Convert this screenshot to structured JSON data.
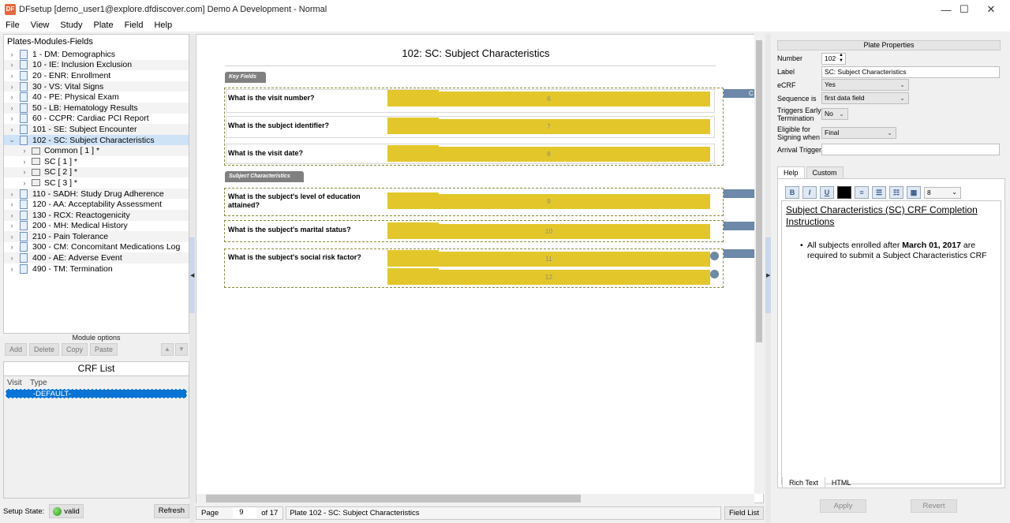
{
  "window": {
    "app_icon": "DF",
    "title": "DFsetup [demo_user1@explore.dfdiscover.com] Demo A Development - Normal",
    "controls": [
      "—",
      "☐",
      "✕"
    ]
  },
  "menu": [
    "File",
    "View",
    "Study",
    "Plate",
    "Field",
    "Help"
  ],
  "tree": {
    "header": "Plates-Modules-Fields",
    "items": [
      {
        "label": "1 - DM: Demographics",
        "expanded": false
      },
      {
        "label": "10 - IE: Inclusion Exclusion",
        "expanded": false
      },
      {
        "label": "20 - ENR: Enrollment",
        "expanded": false
      },
      {
        "label": "30 - VS: Vital Signs",
        "expanded": false
      },
      {
        "label": "40 - PE: Physical Exam",
        "expanded": false
      },
      {
        "label": "50 - LB: Hematology Results",
        "expanded": false
      },
      {
        "label": "60 - CCPR: Cardiac PCI Report",
        "expanded": false
      },
      {
        "label": "101 - SE: Subject Encounter",
        "expanded": false
      },
      {
        "label": "102 - SC: Subject Characteristics",
        "expanded": true,
        "selected": true
      },
      {
        "label": "Common [ 1 ] *",
        "child": true
      },
      {
        "label": "SC [ 1 ] *",
        "child": true
      },
      {
        "label": "SC [ 2 ] *",
        "child": true
      },
      {
        "label": "SC [ 3 ] *",
        "child": true
      },
      {
        "label": "110 - SADH: Study Drug Adherence",
        "expanded": false
      },
      {
        "label": "120 - AA: Acceptability Assessment",
        "expanded": false
      },
      {
        "label": "130 - RCX: Reactogenicity",
        "expanded": false
      },
      {
        "label": "200 - MH: Medical History",
        "expanded": false
      },
      {
        "label": "210 - Pain Tolerance",
        "expanded": false
      },
      {
        "label": "300 - CM: Concomitant Medications Log",
        "expanded": false
      },
      {
        "label": "400 - AE: Adverse Event",
        "expanded": false
      },
      {
        "label": "490 - TM: Termination",
        "expanded": false
      }
    ]
  },
  "module_options": {
    "title": "Module options",
    "buttons": {
      "add": "Add",
      "delete": "Delete",
      "copy": "Copy",
      "paste": "Paste"
    }
  },
  "crf_list": {
    "title": "CRF List",
    "col_visit": "Visit",
    "col_type": "Type",
    "row": "-DEFAULT-"
  },
  "setup": {
    "label": "Setup State:",
    "state": "valid",
    "refresh": "Refresh"
  },
  "plate": {
    "title": "102: SC: Subject Characteristics",
    "sections": [
      "Key Fields",
      "Subject Characteristics"
    ],
    "questions": [
      {
        "label": "What is the visit number?",
        "fields": [
          "6"
        ]
      },
      {
        "label": "What is the subject identifier?",
        "fields": [
          "7"
        ]
      },
      {
        "label": "What is the visit date?",
        "fields": [
          "8"
        ]
      },
      {
        "label": "What is the subject's level of education attained?",
        "fields": [
          "9"
        ]
      },
      {
        "label": "What is the subject's marital status?",
        "fields": [
          "10"
        ]
      },
      {
        "label": "What is the subject's social risk factor?",
        "fields": [
          "11",
          "12"
        ]
      }
    ],
    "edge_marker": "C",
    "field_color": "#e3c72a"
  },
  "status": {
    "page_label": "Page",
    "page": "9",
    "of": "of 17",
    "plate": "Plate 102 - SC: Subject Characteristics",
    "field_list": "Field List"
  },
  "properties": {
    "title": "Plate Properties",
    "number_label": "Number",
    "number": "102",
    "label_label": "Label",
    "label": "SC: Subject Characteristics",
    "ecrf_label": "eCRF",
    "ecrf": "Yes",
    "sequence_label": "Sequence is",
    "sequence": "first data field",
    "triggers_label": "Triggers Early Termination",
    "triggers": "No",
    "eligible_label": "Eligible for Signing when",
    "eligible": "Final",
    "arrival_label": "Arrival Trigger",
    "arrival": ""
  },
  "help": {
    "tabs": [
      "Help",
      "Custom"
    ],
    "font_size": "8",
    "heading": "Subject Characteristics (SC) CRF Completion Instructions",
    "bullet_pre": "All subjects enrolled after ",
    "bullet_bold": "March 01, 2017",
    "bullet_post": " are required to submit a Subject Characteristics CRF",
    "bottom_tabs": [
      "Rich Text",
      "HTML"
    ],
    "apply": "Apply",
    "revert": "Revert"
  }
}
